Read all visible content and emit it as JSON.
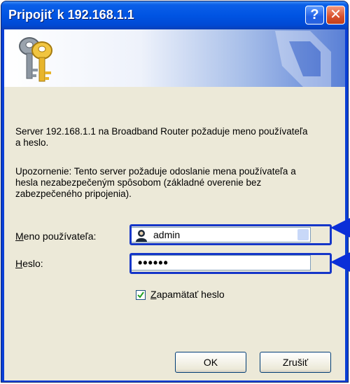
{
  "window": {
    "title": "Pripojiť k 192.168.1.1",
    "help_label": "?",
    "close_label": "✕"
  },
  "dialog": {
    "message": "Server 192.168.1.1 na Broadband Router požaduje meno používateľa a heslo.",
    "warning": "Upozornenie: Tento server požaduje odoslanie mena používateľa a hesla nezabezpečeným spôsobom (základné overenie bez zabezpečeného pripojenia).",
    "username_label_accel": "M",
    "username_label_rest": "eno používateľa:",
    "username_value": "admin",
    "password_label_accel": "H",
    "password_label_rest": "eslo:",
    "password_mask": "••••••",
    "remember_accel": "Z",
    "remember_rest": "apamätať heslo",
    "remember_checked": true,
    "ok_label": "OK",
    "cancel_label": "Zrušiť"
  },
  "colors": {
    "titlebar": "#0054e3",
    "highlight": "#1536c8",
    "arrow": "#0b2fd8"
  },
  "icons": [
    "help-icon",
    "close-icon",
    "keys-icon",
    "user-icon",
    "checkmark-icon",
    "arrow-pointer-icon"
  ]
}
